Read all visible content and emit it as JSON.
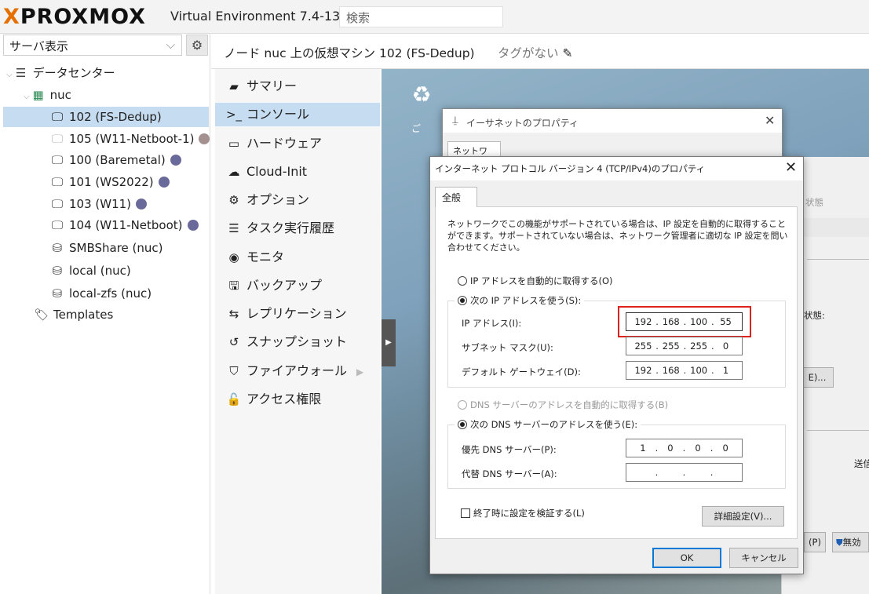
{
  "topbar": {
    "logo_text": "PROXMOX",
    "version": "Virtual Environment 7.4-13",
    "search_placeholder": "検索"
  },
  "sidebar": {
    "view_select": "サーバ表示",
    "items": [
      {
        "label": "データセンター"
      },
      {
        "label": "nuc"
      },
      {
        "label": "102 (FS-Dedup)"
      },
      {
        "label": "105 (W11-Netboot-1)"
      },
      {
        "label": "100 (Baremetal)"
      },
      {
        "label": "101 (WS2022)"
      },
      {
        "label": "103 (W11)"
      },
      {
        "label": "104 (W11-Netboot)"
      },
      {
        "label": "SMBShare (nuc)"
      },
      {
        "label": "local (nuc)"
      },
      {
        "label": "local-zfs (nuc)"
      },
      {
        "label": "Templates"
      }
    ]
  },
  "header": {
    "title": "ノード nuc 上の仮想マシン 102 (FS-Dedup)",
    "tags": "タグがない"
  },
  "menu": {
    "items": [
      {
        "label": "サマリー"
      },
      {
        "label": "コンソール"
      },
      {
        "label": "ハードウェア"
      },
      {
        "label": "Cloud-Init"
      },
      {
        "label": "オプション"
      },
      {
        "label": "タスク実行履歴"
      },
      {
        "label": "モニタ"
      },
      {
        "label": "バックアップ"
      },
      {
        "label": "レプリケーション"
      },
      {
        "label": "スナップショット"
      },
      {
        "label": "ファイアウォール"
      },
      {
        "label": "アクセス権限"
      }
    ]
  },
  "console": {
    "desktop_icon_label": "ご",
    "eth_window": {
      "title": "イーサネットのプロパティ",
      "tab": "ネットワーク"
    },
    "behind_texts": {
      "status1": "状態",
      "status2": "状態:",
      "btn_ellipsis": "E)...",
      "send": "送信",
      "p_btn": "(P)",
      "disable": "無効"
    },
    "dialog": {
      "title": "インターネット プロトコル バージョン 4 (TCP/IPv4)のプロパティ",
      "tab": "全般",
      "intro": "ネットワークでこの機能がサポートされている場合は、IP 設定を自動的に取得することができます。サポートされていない場合は、ネットワーク管理者に適切な IP 設定を問い合わせてください。",
      "radio_auto_ip": "IP アドレスを自動的に取得する(O)",
      "radio_manual_ip": "次の IP アドレスを使う(S):",
      "ip_label": "IP アドレス(I):",
      "ip_value": [
        "192",
        "168",
        "100",
        "55"
      ],
      "subnet_label": "サブネット マスク(U):",
      "subnet_value": [
        "255",
        "255",
        "255",
        "0"
      ],
      "gateway_label": "デフォルト ゲートウェイ(D):",
      "gateway_value": [
        "192",
        "168",
        "100",
        "1"
      ],
      "radio_auto_dns": "DNS サーバーのアドレスを自動的に取得する(B)",
      "radio_manual_dns": "次の DNS サーバーのアドレスを使う(E):",
      "pref_dns_label": "優先 DNS サーバー(P):",
      "pref_dns_value": [
        "1",
        "0",
        "0",
        "0"
      ],
      "alt_dns_label": "代替 DNS サーバー(A):",
      "alt_dns_value": [
        "",
        "",
        "",
        ""
      ],
      "validate_label": "終了時に設定を検証する(L)",
      "advanced_button": "詳細設定(V)...",
      "ok_button": "OK",
      "cancel_button": "キャンセル"
    }
  },
  "colors": {
    "accent_orange": "#e57000",
    "selection_blue": "#c6dcf0",
    "highlight_red": "#e0201a"
  }
}
